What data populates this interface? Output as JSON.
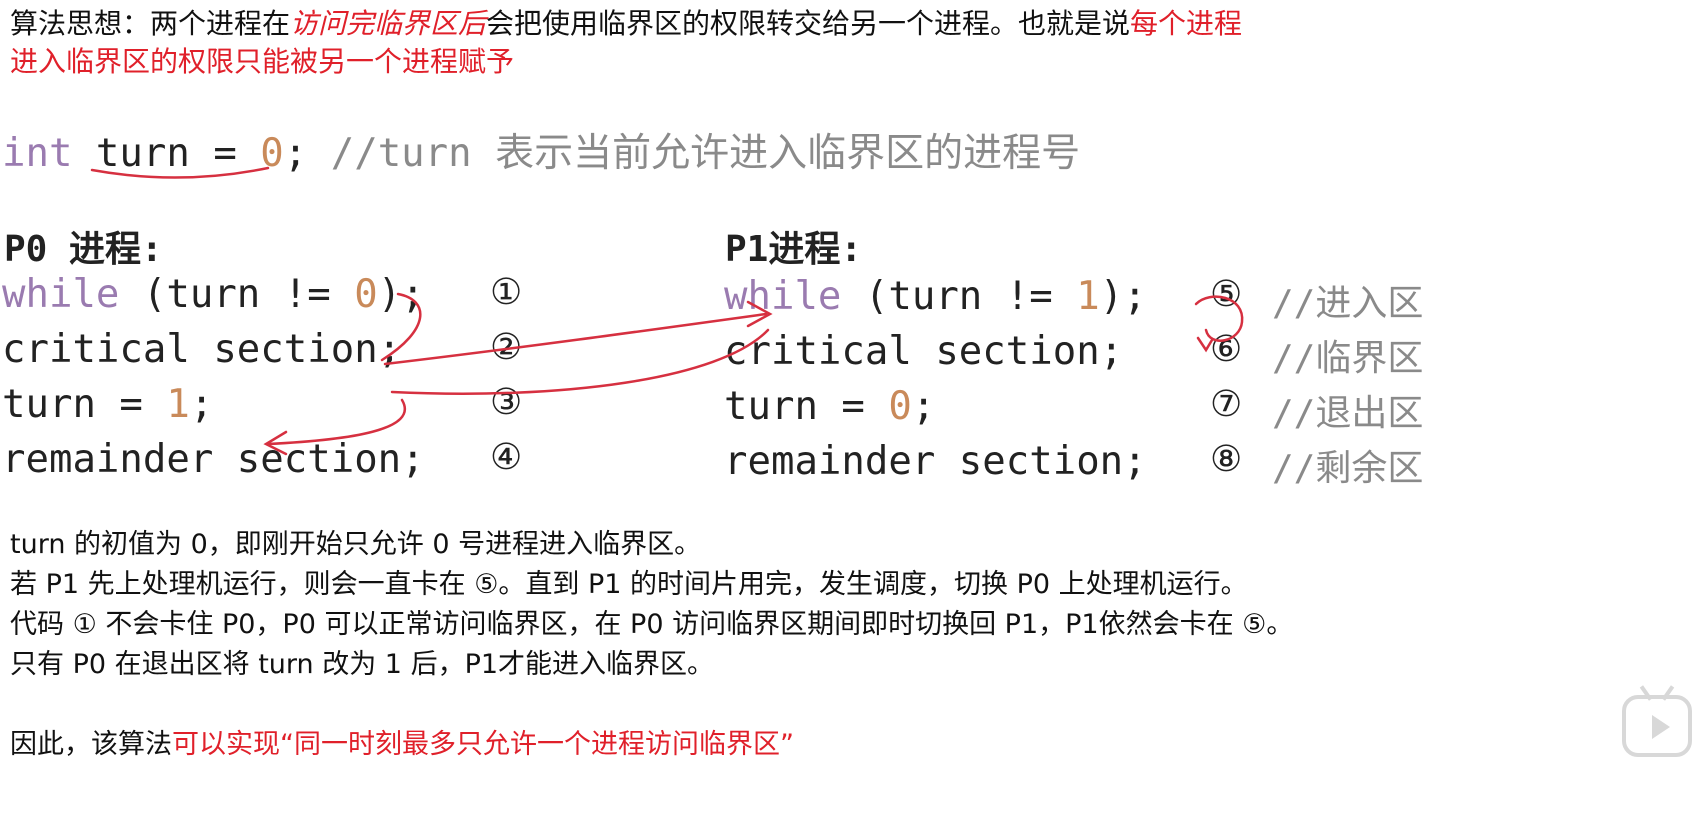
{
  "intro": {
    "part1": "算法思想：两个进程在",
    "emph1": "访问完临界区后",
    "part2": "会把使用临界区的权限转交给另一个进程。也就是说",
    "emph2": "每个进程",
    "line2": "进入临界区的权限只能被另一个进程赋予"
  },
  "decl": {
    "type": "int",
    "rest": " turn = ",
    "value": "0",
    "semi": ";",
    "comment": " //turn 表示当前允许进入临界区的进程号"
  },
  "p0": {
    "label": "P0 进程:",
    "lines": [
      {
        "kw": "while",
        "pre": " (turn != ",
        "num": "0",
        "post": ");",
        "marker": "①"
      },
      {
        "text": "critical section;",
        "marker": "②"
      },
      {
        "pre": "turn = ",
        "num": "1",
        "post": ";",
        "marker": "③"
      },
      {
        "text": "remainder section;",
        "marker": "④"
      }
    ]
  },
  "p1": {
    "label": "P1进程:",
    "lines": [
      {
        "kw": "while",
        "pre": " (turn != ",
        "num": "1",
        "post": ");",
        "marker": "⑤",
        "comment": "//进入区"
      },
      {
        "text": "critical section;",
        "marker": "⑥",
        "comment": "//临界区"
      },
      {
        "pre": "turn = ",
        "num": "0",
        "post": ";",
        "marker": "⑦",
        "comment": "//退出区"
      },
      {
        "text": "remainder section;",
        "marker": "⑧",
        "comment": "//剩余区"
      }
    ]
  },
  "explanation": [
    "turn 的初值为 0，即刚开始只允许 0 号进程进入临界区。",
    "若 P1 先上处理机运行，则会一直卡在 ⑤。直到 P1 的时间片用完，发生调度，切换 P0 上处理机运行。",
    "代码 ① 不会卡住 P0，P0 可以正常访问临界区，在 P0 访问临界区期间即时切换回 P1，P1依然会卡在 ⑤。",
    "只有 P0 在退出区将 turn 改为 1 后，P1才能进入临界区。"
  ],
  "conclusion": {
    "prefix": "因此，该算法",
    "emph": "可以实现“同一时刻最多只允许一个进程访问临界区”"
  },
  "colors": {
    "emphasis": "#e0202a",
    "keyword": "#9a7bb0",
    "number": "#c98a5a",
    "comment": "#8a8a8a",
    "annotation": "#d63040"
  },
  "icons": {
    "logo": "bilibili-tv-icon"
  }
}
